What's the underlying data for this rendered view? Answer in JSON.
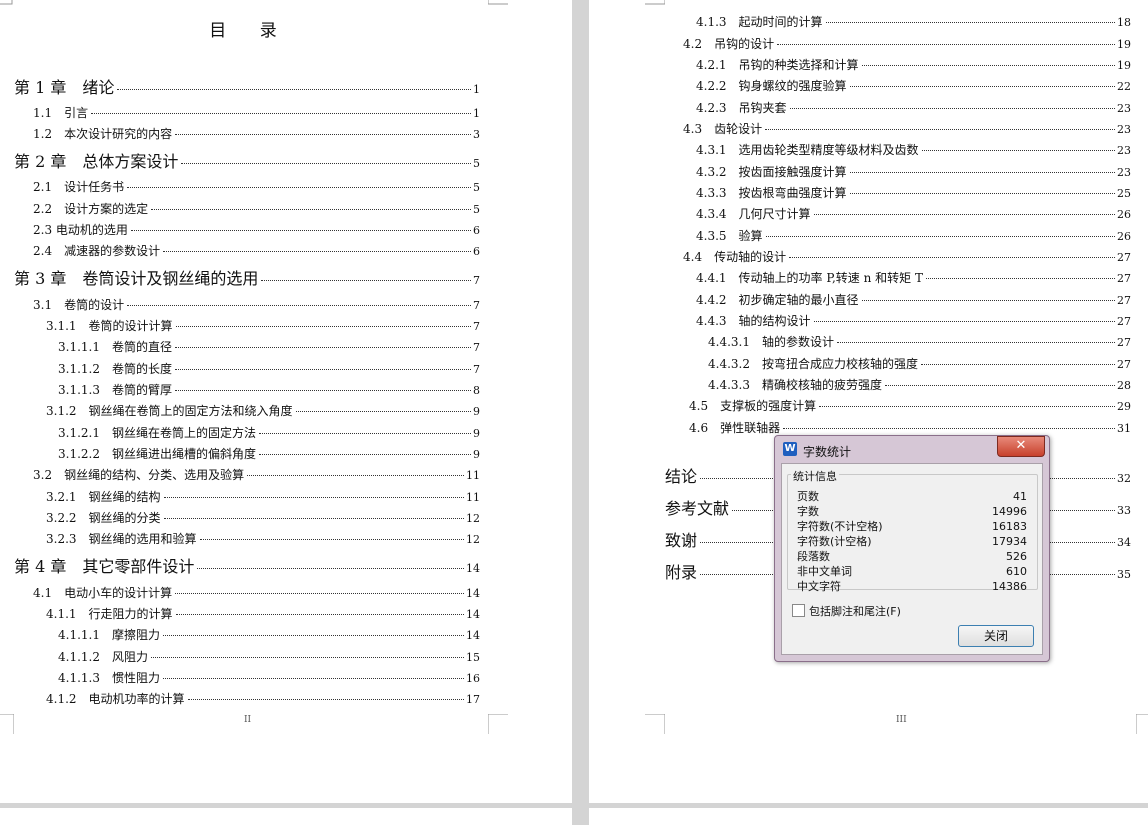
{
  "left_page": {
    "title": "目 录",
    "footer": "II",
    "entries": [
      {
        "text": "第 1 章　绪论",
        "page": "1",
        "level": "chap"
      },
      {
        "text": "1.1　引言",
        "page": "1",
        "level": 1
      },
      {
        "text": "1.2　本次设计研究的内容",
        "page": "3",
        "level": 1
      },
      {
        "text": "第 2 章　总体方案设计",
        "page": "5",
        "level": "chap"
      },
      {
        "text": "2.1　设计任务书",
        "page": "5",
        "level": 1
      },
      {
        "text": "2.2　设计方案的选定",
        "page": "5",
        "level": 1
      },
      {
        "text": "2.3 电动机的选用",
        "page": "6",
        "level": 1
      },
      {
        "text": "2.4　减速器的参数设计",
        "page": "6",
        "level": 1
      },
      {
        "text": "第 3 章　卷筒设计及钢丝绳的选用",
        "page": "7",
        "level": "chap"
      },
      {
        "text": "3.1　卷筒的设计",
        "page": "7",
        "level": 1
      },
      {
        "text": "3.1.1　卷筒的设计计算",
        "page": "7",
        "level": 2
      },
      {
        "text": "3.1.1.1　卷筒的直径",
        "page": "7",
        "level": 3
      },
      {
        "text": "3.1.1.2　卷筒的长度",
        "page": "7",
        "level": 3
      },
      {
        "text": "3.1.1.3　卷筒的臂厚",
        "page": "8",
        "level": 3
      },
      {
        "text": "3.1.2　钢丝绳在卷筒上的固定方法和绕入角度",
        "page": "9",
        "level": 2
      },
      {
        "text": "3.1.2.1　钢丝绳在卷筒上的固定方法",
        "page": "9",
        "level": 3
      },
      {
        "text": "3.1.2.2　钢丝绳进出绳槽的偏斜角度",
        "page": "9",
        "level": 3
      },
      {
        "text": "3.2　钢丝绳的结构、分类、选用及验算",
        "page": "11",
        "level": 1
      },
      {
        "text": "3.2.1　钢丝绳的结构",
        "page": "11",
        "level": 2
      },
      {
        "text": "3.2.2　钢丝绳的分类",
        "page": "12",
        "level": 2
      },
      {
        "text": "3.2.3　钢丝绳的选用和验算",
        "page": "12",
        "level": 2
      },
      {
        "text": "第 4 章　其它零部件设计",
        "page": "14",
        "level": "chap"
      },
      {
        "text": "4.1　电动小车的设计计算",
        "page": "14",
        "level": 1
      },
      {
        "text": "4.1.1　行走阻力的计算",
        "page": "14",
        "level": 2
      },
      {
        "text": "4.1.1.1　摩擦阻力",
        "page": "14",
        "level": 3
      },
      {
        "text": "4.1.1.2　风阻力",
        "page": "15",
        "level": 3
      },
      {
        "text": "4.1.1.3　惯性阻力",
        "page": "16",
        "level": 3
      },
      {
        "text": "4.1.2　电动机功率的计算",
        "page": "17",
        "level": 2
      }
    ]
  },
  "right_page": {
    "footer": "III",
    "entries": [
      {
        "text": "4.1.3　起动时间的计算",
        "page": "18",
        "level": 2
      },
      {
        "text": "4.2　吊钩的设计",
        "page": "19",
        "level": 1
      },
      {
        "text": "4.2.1　吊钩的种类选择和计算",
        "page": "19",
        "level": 2
      },
      {
        "text": "4.2.2　钩身螺纹的强度验算",
        "page": "22",
        "level": 2
      },
      {
        "text": "4.2.3　吊钩夹套",
        "page": "23",
        "level": 2
      },
      {
        "text": "4.3　齿轮设计",
        "page": "23",
        "level": 1
      },
      {
        "text": "4.3.1　选用齿轮类型精度等级材料及齿数",
        "page": "23",
        "level": 2
      },
      {
        "text": "4.3.2　按齿面接触强度计算",
        "page": "23",
        "level": 2
      },
      {
        "text": "4.3.3　按齿根弯曲强度计算",
        "page": "25",
        "level": 2
      },
      {
        "text": "4.3.4　几何尺寸计算",
        "page": "26",
        "level": 2
      },
      {
        "text": "4.3.5　验算",
        "page": "26",
        "level": 2
      },
      {
        "text": "4.4　传动轴的设计",
        "page": "27",
        "level": 1
      },
      {
        "text": "4.4.1　传动轴上的功率 P,转速 n 和转矩 T",
        "page": "27",
        "level": 2
      },
      {
        "text": "4.4.2　初步确定轴的最小直径",
        "page": "27",
        "level": 2
      },
      {
        "text": "4.4.3　轴的结构设计",
        "page": "27",
        "level": 2
      },
      {
        "text": "4.4.3.1　轴的参数设计",
        "page": "27",
        "level": 3
      },
      {
        "text": "4.4.3.2　按弯扭合成应力校核轴的强度",
        "page": "27",
        "level": 3
      },
      {
        "text": "4.4.3.3　精确校核轴的疲劳强度",
        "page": "28",
        "level": 3
      },
      {
        "text": "4.5　支撑板的强度计算",
        "page": "29",
        "level": 1
      },
      {
        "text": "4.6　弹性联轴器",
        "page": "31",
        "level": 1
      },
      {
        "text": "结论",
        "page": "32",
        "level": "chap"
      },
      {
        "text": "参考文献",
        "page": "33",
        "level": "chap"
      },
      {
        "text": "致谢",
        "page": "34",
        "level": "chap"
      },
      {
        "text": "附录",
        "page": "35",
        "level": "chap"
      }
    ]
  },
  "dialog": {
    "title": "字数统计",
    "app_icon": "W",
    "close_glyph": "✕",
    "group_label": "统计信息",
    "stats": [
      {
        "label": "页数",
        "value": "41"
      },
      {
        "label": "字数",
        "value": "14996"
      },
      {
        "label": "字符数(不计空格)",
        "value": "16183"
      },
      {
        "label": "字符数(计空格)",
        "value": "17934"
      },
      {
        "label": "段落数",
        "value": "526"
      },
      {
        "label": "非中文单词",
        "value": "610"
      },
      {
        "label": "中文字符",
        "value": "14386"
      }
    ],
    "checkbox_label": "包括脚注和尾注(F)",
    "checkbox_checked": false,
    "ok_label": "关闭"
  }
}
